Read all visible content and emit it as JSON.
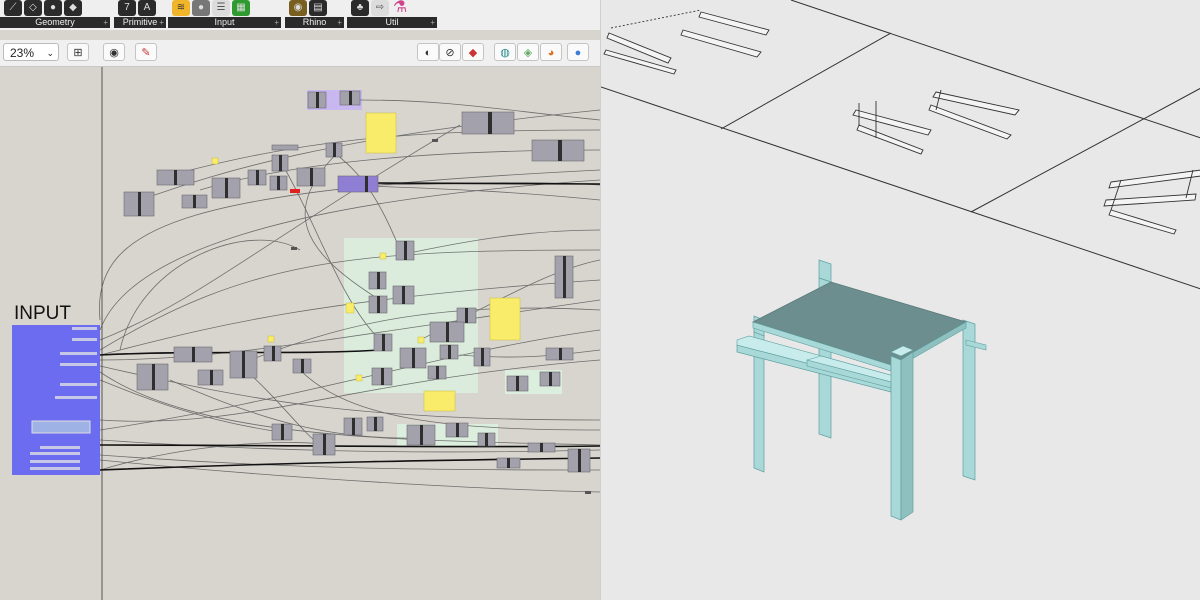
{
  "toolbar": {
    "tabs": [
      {
        "label": "Geometry"
      },
      {
        "label": "Primitive"
      },
      {
        "label": "Input"
      },
      {
        "label": "Rhino"
      },
      {
        "label": "Util"
      }
    ],
    "plus": "+"
  },
  "canvas_bar": {
    "zoom": "23%",
    "zoom_caret": "⌄"
  },
  "canvas": {
    "input_group_label": "INPUT"
  },
  "colors": {
    "canvas_bg": "#d8d5cf",
    "input_group": "#6c6cf0",
    "panel_yellow": "#f8ec6a",
    "component_grey": "#a3a1ab",
    "cluster_purple": "#8f7fd4",
    "group_green": "#dceedd",
    "viewport_bg": "#e8e8e8",
    "table_cyan": "#a8d8d8",
    "table_top": "#6c8e8e"
  },
  "icons": [
    "geometry-icons",
    "primitive-icons",
    "input-slider-icon",
    "rhino-icon",
    "util-icon",
    "preview-eye-icon",
    "zoom-fit-icon",
    "render-sphere-icon"
  ]
}
